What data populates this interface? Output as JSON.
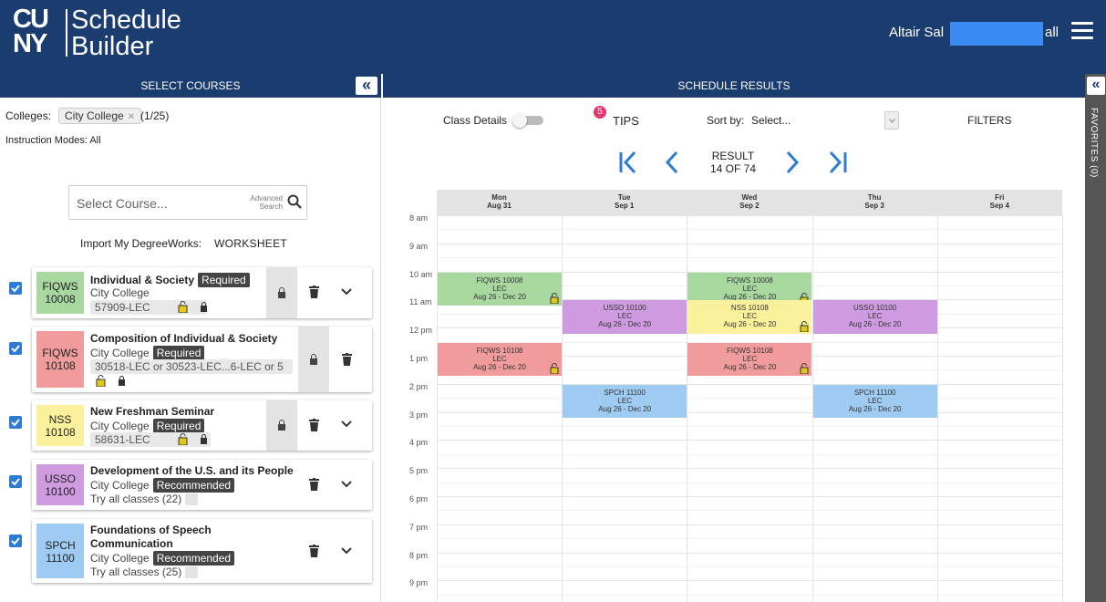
{
  "header": {
    "logo_mark_line1": "CU",
    "logo_mark_line2": "NY",
    "logo_line1": "Schedule",
    "logo_line2": "Builder",
    "user_name_prefix": "Altair Sal",
    "user_name_suffix": "all"
  },
  "left_bar": {
    "title": "SELECT COURSES",
    "collapse": "«"
  },
  "right_bar": {
    "title": "SCHEDULE RESULTS"
  },
  "filters": {
    "colleges_label": "Colleges:",
    "college_chip": "City College",
    "college_count": "(1/25)",
    "modes_label": "Instruction Modes:",
    "modes_value": "All"
  },
  "search": {
    "placeholder": "Select Course...",
    "advanced_line1": "Advanced",
    "advanced_line2": "Search"
  },
  "import": {
    "label": "Import My DegreeWorks:",
    "link": "WORKSHEET"
  },
  "courses": [
    {
      "code1": "FIQWS",
      "code2": "10008",
      "color": "#a8d8a0",
      "title": "Individual & Society",
      "badge": "Required",
      "college": "City College",
      "section": "57909-LEC"
    },
    {
      "code1": "FIQWS",
      "code2": "10108",
      "color": "#f19c9c",
      "title": "Composition of Individual & Society",
      "badge": "Required",
      "college": "City College",
      "section": "30518-LEC or 30523-LEC...6-LEC or 5"
    },
    {
      "code1": "NSS",
      "code2": "10108",
      "color": "#fbf19c",
      "title": "New Freshman Seminar",
      "badge": "Required",
      "college": "City College",
      "section": "58631-LEC"
    },
    {
      "code1": "USSO",
      "code2": "10100",
      "color": "#cf9be0",
      "title": "Development of the U.S. and its People",
      "badge": "Recommended",
      "college": "City College",
      "try": "Try all classes (22)"
    },
    {
      "code1": "SPCH",
      "code2": "11100",
      "color": "#9fcaf2",
      "title_line1": "Foundations of Speech",
      "title_line2": "Communication",
      "badge": "Recommended",
      "college": "City College",
      "try": "Try all classes (25)"
    }
  ],
  "toolbar": {
    "class_details": "Class Details",
    "tips_count": "5",
    "tips": "TIPS",
    "sort_by": "Sort by:",
    "sort_value": "Select...",
    "filters": "FILTERS"
  },
  "result": {
    "line1": "RESULT",
    "line2": "14 OF 74"
  },
  "calendar": {
    "days": [
      {
        "name": "Mon",
        "date": "Aug 31"
      },
      {
        "name": "Tue",
        "date": "Sep 1"
      },
      {
        "name": "Wed",
        "date": "Sep 2"
      },
      {
        "name": "Thu",
        "date": "Sep 3"
      },
      {
        "name": "Fri",
        "date": "Sep 4"
      }
    ],
    "times": [
      "8 am",
      "9 am",
      "10 am",
      "11 am",
      "12 pm",
      "1 pm",
      "2 pm",
      "3 pm",
      "4 pm",
      "5 pm",
      "6 pm",
      "7 pm",
      "8 pm",
      "9 pm"
    ],
    "events": [
      {
        "course": "FIQWS 10008",
        "type": "LEC",
        "dates": "Aug 26 - Dec 20",
        "day": "Mon",
        "color": "#a8d8a0",
        "lock": true
      },
      {
        "course": "FIQWS 10008",
        "type": "LEC",
        "dates": "Aug 26 - Dec 20",
        "day": "Wed",
        "color": "#a8d8a0",
        "lock": true
      },
      {
        "course": "USSO 10100",
        "type": "LEC",
        "dates": "Aug 26 - Dec 20",
        "day": "Tue",
        "color": "#cf9be0",
        "lock": false
      },
      {
        "course": "NSS 10108",
        "type": "LEC",
        "dates": "Aug 26 - Dec 20",
        "day": "Wed",
        "color": "#fbf19c",
        "lock": true
      },
      {
        "course": "USSO 10100",
        "type": "LEC",
        "dates": "Aug 26 - Dec 20",
        "day": "Thu",
        "color": "#cf9be0",
        "lock": false
      },
      {
        "course": "FIQWS 10108",
        "type": "LEC",
        "dates": "Aug 26 - Dec 20",
        "day": "Mon",
        "color": "#f19c9c",
        "lock": true
      },
      {
        "course": "FIQWS 10108",
        "type": "LEC",
        "dates": "Aug 26 - Dec 20",
        "day": "Wed",
        "color": "#f19c9c",
        "lock": true
      },
      {
        "course": "SPCH 11100",
        "type": "LEC",
        "dates": "Aug 26 - Dec 20",
        "day": "Tue",
        "color": "#9fcaf2",
        "lock": false
      },
      {
        "course": "SPCH 11100",
        "type": "LEC",
        "dates": "Aug 26 - Dec 20",
        "day": "Thu",
        "color": "#9fcaf2",
        "lock": false
      }
    ]
  },
  "favorites": {
    "label": "FAVORITES (0)",
    "collapse": "«"
  },
  "colors": {
    "header_bg": "#1a3c6e",
    "accent_blue": "#2e7bd6",
    "tips_badge": "#e8356a"
  }
}
